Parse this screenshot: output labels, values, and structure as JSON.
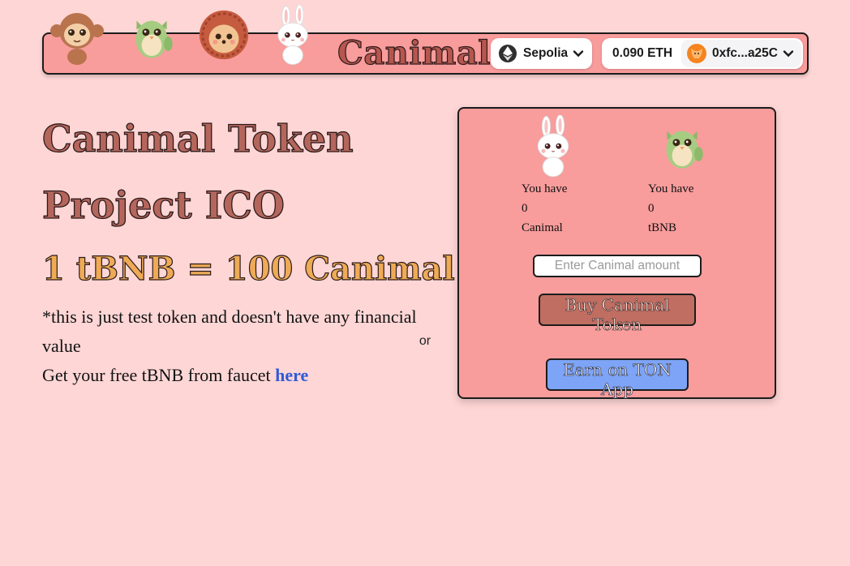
{
  "header": {
    "brand": "Canimal",
    "network": {
      "label": "Sepolia",
      "icon": "ethereum-icon"
    },
    "account": {
      "balance": "0.090 ETH",
      "address": "0xfc...a25C",
      "icon": "metamask-fox-icon"
    },
    "mascots": [
      "monkey-mascot",
      "owl-mascot",
      "hedgehog-mascot",
      "bunny-mascot"
    ]
  },
  "hero": {
    "title_line1": "Canimal Token",
    "title_line2": "Project ICO",
    "rate": "1 tBNB = 100 Canimal",
    "disclaimer": "*this is just test token and doesn't have any financial value",
    "faucet_prefix": "Get your free tBNB from faucet ",
    "faucet_link": "here"
  },
  "swap": {
    "canimal": {
      "label": "You have",
      "amount": "0",
      "unit": "Canimal",
      "mascot": "bunny-mascot"
    },
    "tbnb": {
      "label": "You have",
      "amount": "0",
      "unit": "tBNB",
      "mascot": "owl-mascot"
    },
    "input_placeholder": "Enter Canimal amount",
    "buy_label": "Buy Canimal Token",
    "or_label": "or",
    "ton_label": "Earn on TON App"
  },
  "colors": {
    "background": "#ffd6d6",
    "panel": "#f99c9c",
    "title": "#b5665c",
    "rate": "#eeaa55",
    "buy_button": "#c06d62",
    "ton_button": "#7da4f6",
    "link": "#2e5bd6"
  }
}
